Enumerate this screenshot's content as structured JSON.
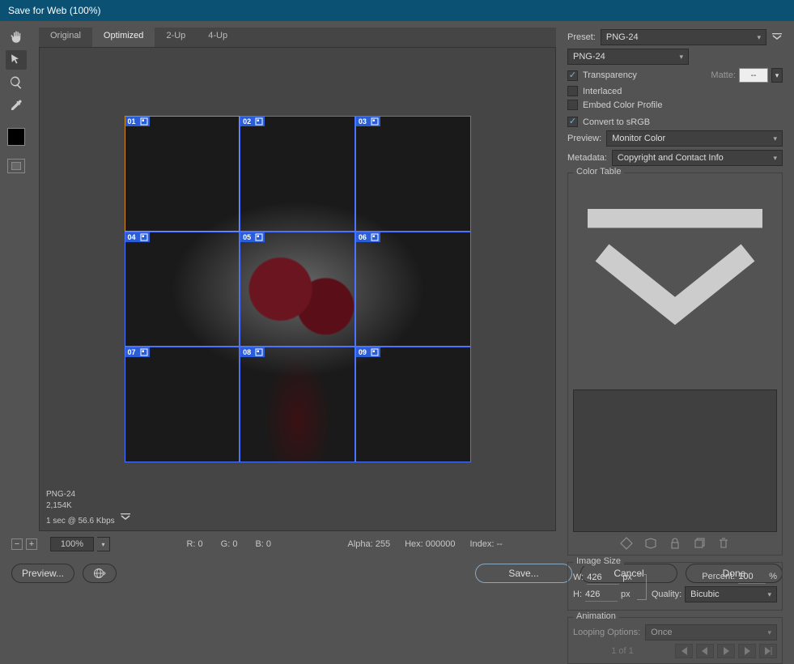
{
  "title": "Save for Web (100%)",
  "tabs": {
    "original": "Original",
    "optimized": "Optimized",
    "twoup": "2-Up",
    "fourup": "4-Up"
  },
  "slices": [
    "01",
    "02",
    "03",
    "04",
    "05",
    "06",
    "07",
    "08",
    "09"
  ],
  "canvasInfo": {
    "format": "PNG-24",
    "size": "2,154K",
    "time": "1 sec @ 56.6 Kbps"
  },
  "status": {
    "zoom": "100%",
    "r": "R: 0",
    "g": "G: 0",
    "b": "B: 0",
    "alpha": "Alpha: 255",
    "hex": "Hex: 000000",
    "index": "Index: --"
  },
  "right": {
    "presetLabel": "Preset:",
    "presetValue": "PNG-24",
    "formatValue": "PNG-24",
    "transparency": "Transparency",
    "matteLabel": "Matte:",
    "matteValue": "--",
    "interlaced": "Interlaced",
    "embedProfile": "Embed Color Profile",
    "convertSrgb": "Convert to sRGB",
    "previewLabel": "Preview:",
    "previewValue": "Monitor Color",
    "metadataLabel": "Metadata:",
    "metadataValue": "Copyright and Contact Info",
    "colorTable": "Color Table",
    "imageSize": "Image Size",
    "wLabel": "W:",
    "wValue": "426",
    "hLabel": "H:",
    "hValue": "426",
    "pxLabel": "px",
    "percentLabel": "Percent:",
    "percentValue": "100",
    "percentUnit": "%",
    "qualityLabel": "Quality:",
    "qualityValue": "Bicubic",
    "animation": "Animation",
    "loopLabel": "Looping Options:",
    "loopValue": "Once",
    "page": "1 of 1"
  },
  "footer": {
    "preview": "Preview...",
    "save": "Save...",
    "cancel": "Cancel",
    "done": "Done"
  }
}
